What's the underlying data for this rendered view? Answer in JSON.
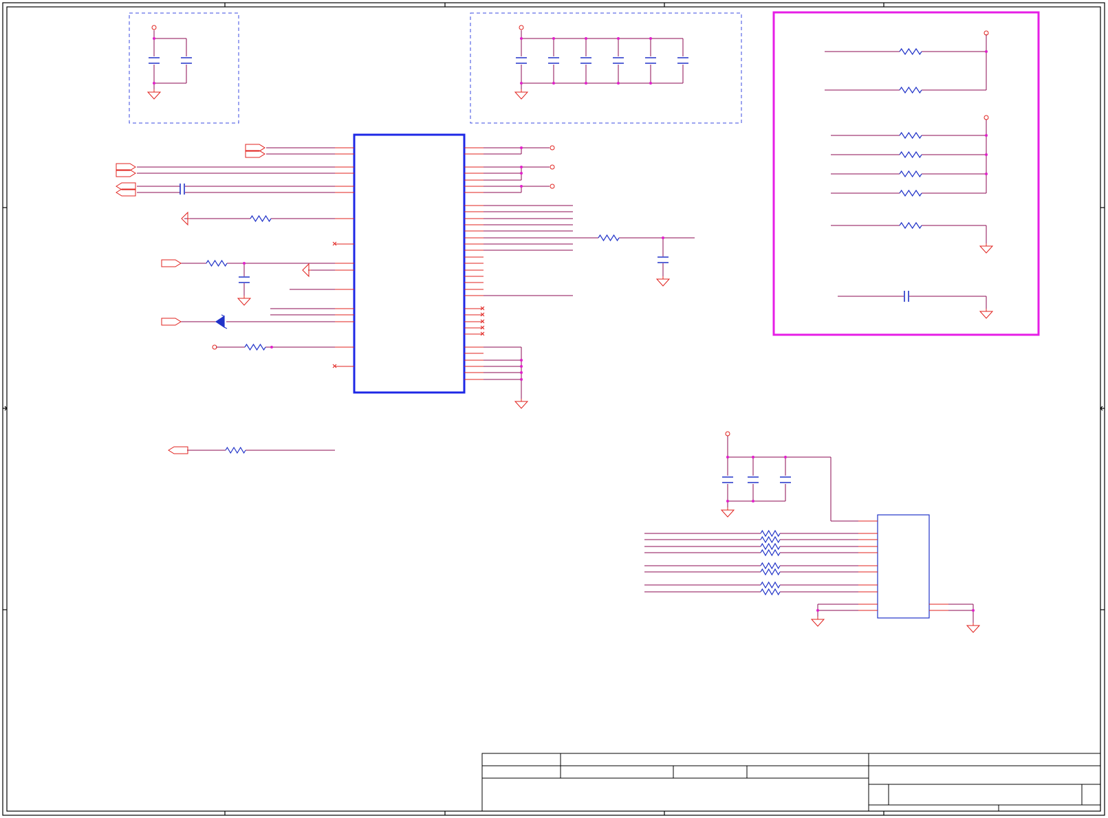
{
  "sheet": {
    "title_block_cells": [
      "",
      "",
      "",
      "",
      "",
      "",
      "",
      "",
      "",
      "",
      ""
    ]
  },
  "colors": {
    "wire": "#8b0a50",
    "pin": "#e0201c",
    "junction": "#e020c8",
    "component": "#2032c8",
    "ic_outline": "#1e28e6",
    "group_box": "#3a4ae0",
    "highlight_box": "#e61ee6",
    "border": "#000000"
  },
  "symbols": {
    "capacitor": "capacitor-icon",
    "resistor": "resistor-icon",
    "ground": "ground-icon",
    "power_port": "power-port-icon",
    "zener_diode": "zener-diode-icon",
    "offsheet_connector": "offsheet-connector-icon",
    "no_connect": "no-connect-icon"
  }
}
